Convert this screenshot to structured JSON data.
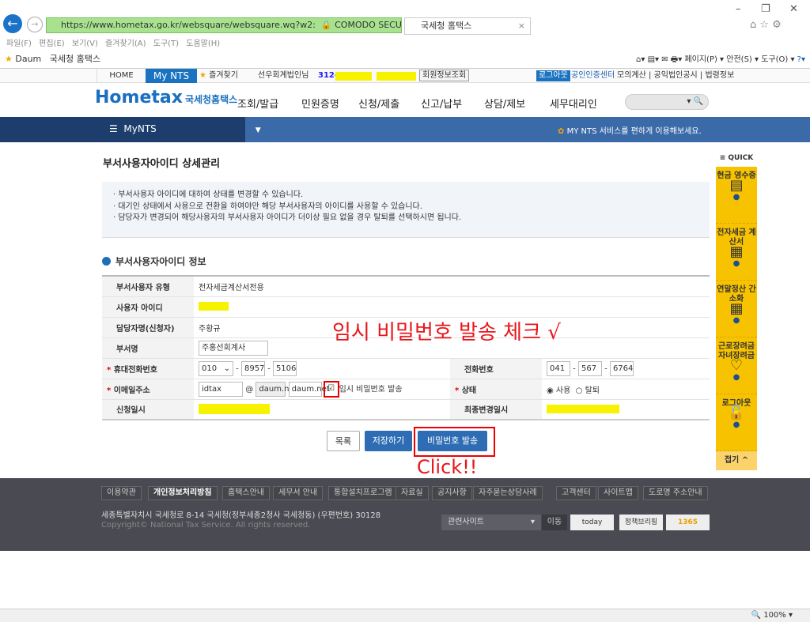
{
  "browser": {
    "url": "https://www.hometax.go.kr/websquare/websquare.wq?w2:",
    "security": "COMODO SECURE™(으)...",
    "tab_title": "국세청 홈택스",
    "menu": [
      "파일(F)",
      "편집(E)",
      "보기(V)",
      "즐겨찾기(A)",
      "도구(T)",
      "도움말(H)"
    ],
    "favorites": [
      "Daum",
      "국세청 홈택스"
    ],
    "toolbar": [
      "페이지(P) ▾",
      "안전(S) ▾",
      "도구(O) ▾"
    ],
    "zoom": "100%"
  },
  "topbar": {
    "home": "HOME",
    "mynts": "My NTS",
    "bookmark": "즐겨찾기",
    "user": "선우회계법인님",
    "user_id": "312-",
    "member_info": "회원정보조회",
    "logout": "로그아웃",
    "cert": "공인인증센터",
    "links": [
      "모의계산",
      "공익법인공시",
      "법령정보"
    ]
  },
  "nav": {
    "logo": "Hometax",
    "logo_sub": "국세청홈택스",
    "menus": [
      "조회/발급",
      "민원증명",
      "신청/제출",
      "신고/납부",
      "상담/제보",
      "세무대리인"
    ]
  },
  "band": {
    "menu": "MyNTS",
    "message": "MY NTS 서비스를 편하게 이용해보세요."
  },
  "page": {
    "title": "부서사용자아이디 상세관리",
    "notices": [
      "부서사용자 아이디에 대하여 상태를 변경할 수 있습니다.",
      "대기인 상태에서 사용으로 전환을 하여야만 해당 부서사용자의 아이디를 사용할 수 있습니다.",
      "담당자가 변경되어 해당사용자의 부서사용자 아이디가 더이상 필요 없을 경우 탈퇴를 선택하시면 됩니다."
    ],
    "section": "부서사용자아이디 정보"
  },
  "form": {
    "type_label": "부서사용자 유형",
    "type_value": "전자세금계산서전용",
    "id_label": "사용자 아이디",
    "manager_label": "담당자명(신청자)",
    "manager_value": "주황규",
    "dept_label": "부서명",
    "dept_value": "주홍선회계사",
    "mobile_label": "휴대전화번호",
    "mobile": [
      "010",
      "8957",
      "5106"
    ],
    "phone_label": "전화번호",
    "phone": [
      "041",
      "567",
      "6764"
    ],
    "email_label": "이메일주소",
    "email_id": "idtax",
    "email_at": "@",
    "email_domain": "daum.net",
    "email_select": "daum.net",
    "temp_pw_label": "임시 비밀번호 발송",
    "status_label": "상태",
    "status_options": [
      "사용",
      "탈퇴"
    ],
    "applied_label": "신청일시",
    "modified_label": "최종변경일시"
  },
  "buttons": {
    "list": "목록",
    "save": "저장하기",
    "send_pw": "비밀번호 발송"
  },
  "annotations": {
    "check": "임시 비밀번호 발송 체크 √",
    "click": "Click!!"
  },
  "quick": {
    "title": "≡ QUICK",
    "items": [
      "현금 영수증",
      "전자세금 계산서",
      "연말정산 간소화",
      "근로장려금 자녀장려금",
      "로그아웃"
    ],
    "fold": "접기 ^"
  },
  "footer": {
    "links": [
      "이용약관",
      "개인정보처리방침",
      "홈택스안내",
      "세무서 안내",
      "통합설치프로그램",
      "자료실",
      "공지사항",
      "자주묻는상담사례",
      "고객센터",
      "사이트맵",
      "도로명 주소안내"
    ],
    "address": "세종특별자치시 국세청로 8-14 국세청(정부세종2청사 국세청동) (우편번호) 30128",
    "copyright": "Copyright© National Tax Service. All rights reserved.",
    "related": "관련사이트",
    "go": "이동",
    "banners": [
      "today",
      "정책브리핑",
      "1365"
    ]
  }
}
